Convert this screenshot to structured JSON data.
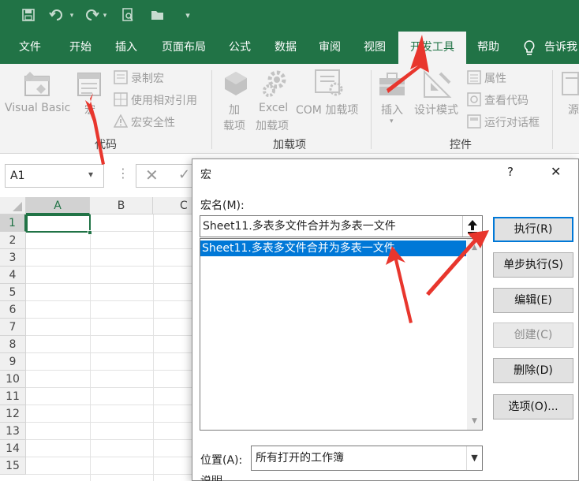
{
  "qat": {
    "icons": [
      "save-icon",
      "undo-icon",
      "redo-icon",
      "print-preview-icon",
      "open-icon",
      "customize-icon"
    ]
  },
  "tabs": [
    {
      "label": "文件"
    },
    {
      "label": "开始"
    },
    {
      "label": "插入"
    },
    {
      "label": "页面布局"
    },
    {
      "label": "公式"
    },
    {
      "label": "数据"
    },
    {
      "label": "审阅"
    },
    {
      "label": "视图"
    },
    {
      "label": "开发工具",
      "active": true
    },
    {
      "label": "帮助"
    }
  ],
  "tell_me": "告诉我",
  "ribbon": {
    "code": {
      "visual_basic": "Visual Basic",
      "macros": "宏",
      "record_macro": "录制宏",
      "relative_refs": "使用相对引用",
      "macro_security": "宏安全性",
      "group_label": "代码"
    },
    "addins": {
      "addins_line1": "加",
      "addins_line2": "载项",
      "excel_addins_line1": "Excel",
      "excel_addins_line2": "加载项",
      "com_addins": "COM 加载项",
      "group_label": "加载项"
    },
    "controls": {
      "insert": "插入",
      "design_mode": "设计模式",
      "properties": "属性",
      "view_code": "查看代码",
      "run_dialog": "运行对话框",
      "group_label": "控件"
    },
    "source_partial": "源"
  },
  "namebox": {
    "value": "A1"
  },
  "sheet": {
    "columns": [
      "A",
      "B",
      "C"
    ],
    "rows": [
      "1",
      "2",
      "3",
      "4",
      "5",
      "6",
      "7",
      "8",
      "9",
      "10",
      "11",
      "12",
      "13",
      "14",
      "15"
    ]
  },
  "dialog": {
    "title": "宏",
    "help": "?",
    "close": "✕",
    "macro_name_label": "宏名(M):",
    "macro_name_value": "Sheet11.多表多文件合并为多表一文件",
    "macros": [
      "Sheet11.多表多文件合并为多表一文件"
    ],
    "buttons": {
      "run": "执行(R)",
      "step_into": "单步执行(S)",
      "edit": "编辑(E)",
      "create": "创建(C)",
      "delete": "删除(D)",
      "options": "选项(O)..."
    },
    "location_label": "位置(A):",
    "location_value": "所有打开的工作簿",
    "description_partial": "说明"
  },
  "colors": {
    "excel_green": "#217346",
    "selection_blue": "#0078d7",
    "annotation_red": "#e8362d"
  }
}
